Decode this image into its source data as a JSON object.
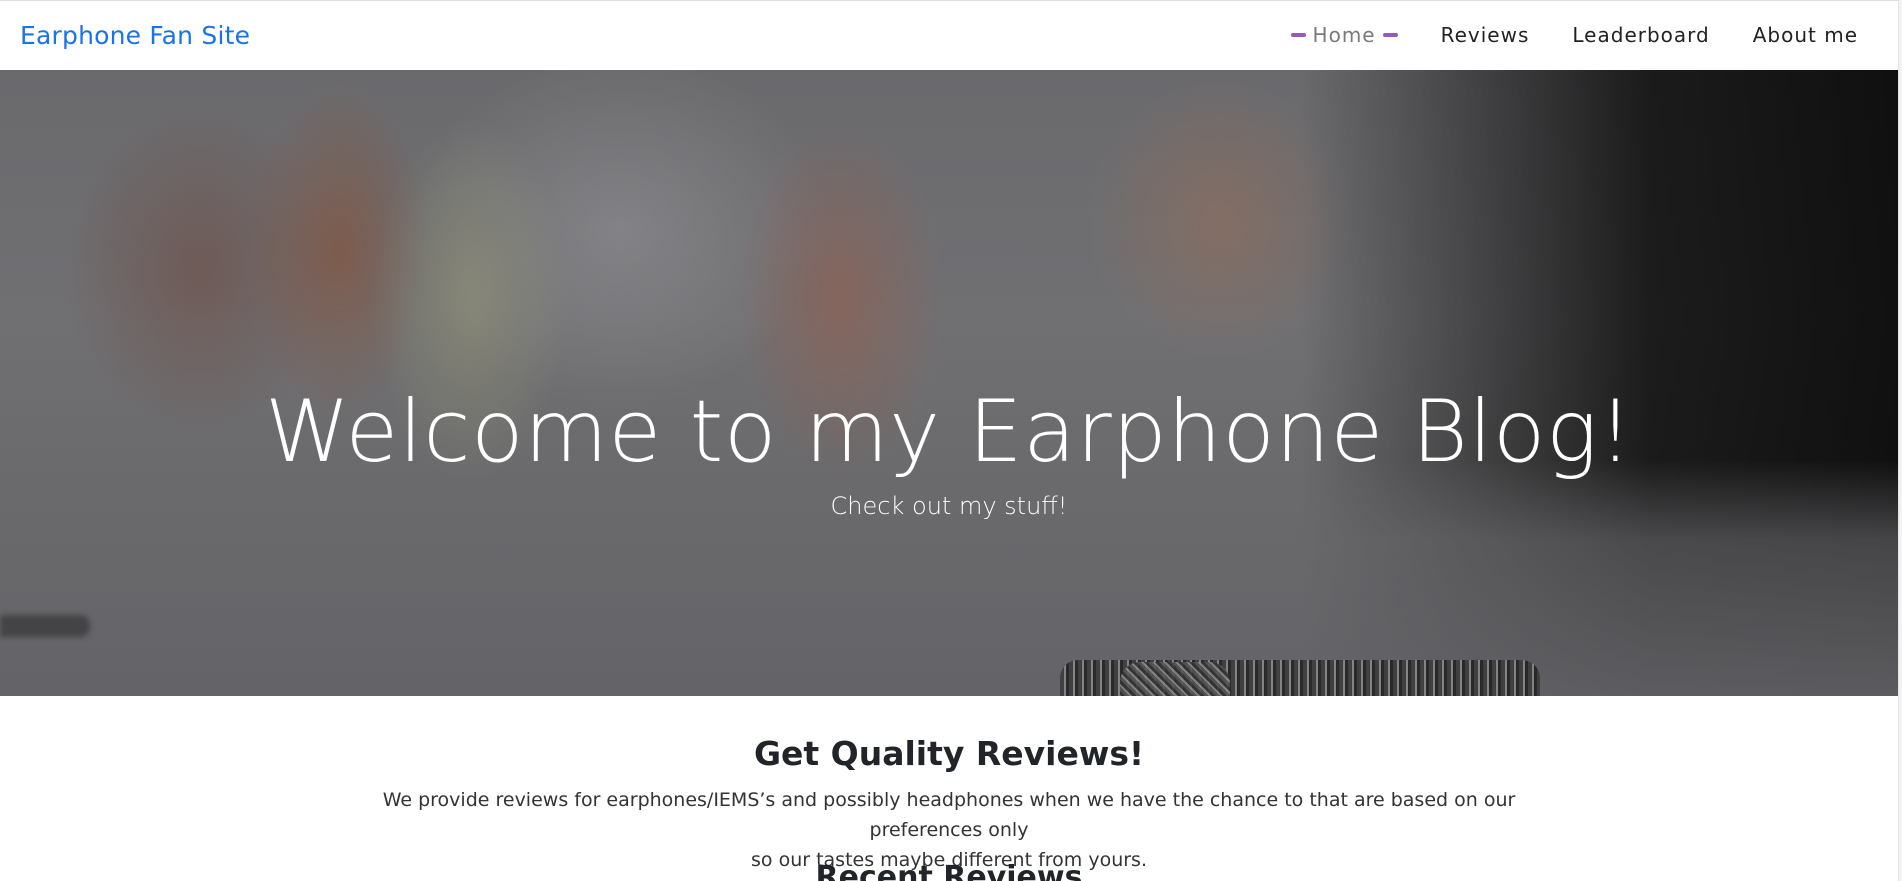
{
  "navbar": {
    "brand": "Earphone Fan Site",
    "items": [
      {
        "label": "Home",
        "active": true
      },
      {
        "label": "Reviews",
        "active": false
      },
      {
        "label": "Leaderboard",
        "active": false
      },
      {
        "label": "About me",
        "active": false
      }
    ],
    "active_indicator_color": "#9b59b6",
    "brand_color": "#1a73e8"
  },
  "hero": {
    "title": "Welcome to my Earphone Blog!",
    "subtitle": "Check out my stuff!"
  },
  "intro": {
    "title": "Get Quality Reviews!",
    "text_line1": "We provide reviews for earphones/IEMS’s and possibly headphones when we have the chance to that are based on our preferences only",
    "text_line2": "so our tastes maybe different from yours."
  },
  "recent": {
    "title": "Recent Reviews"
  }
}
